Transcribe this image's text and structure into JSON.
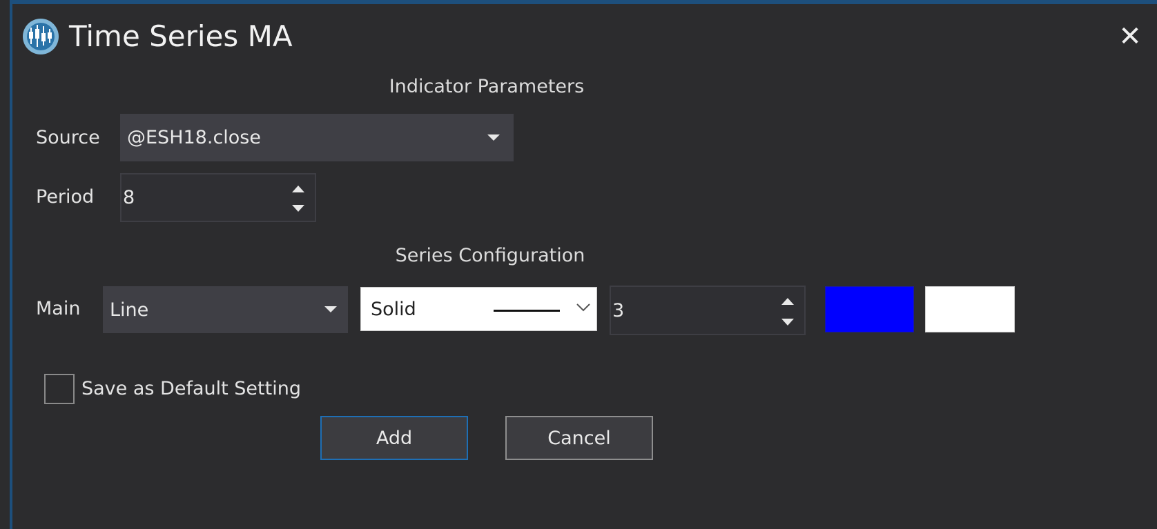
{
  "window": {
    "title": "Time Series MA",
    "close_symbol": "✕",
    "app_icon": "candlestick-chart-icon"
  },
  "indicator_parameters": {
    "heading": "Indicator Parameters",
    "source": {
      "label": "Source",
      "value": "@ESH18.close"
    },
    "period": {
      "label": "Period",
      "value": "8"
    }
  },
  "series_configuration": {
    "heading": "Series Configuration",
    "main": {
      "label": "Main",
      "plot_type": "Line",
      "line_style": "Solid",
      "width": "3",
      "color_1": "#0000ff",
      "color_2": "#ffffff"
    }
  },
  "save_default": {
    "label": "Save as Default Setting",
    "checked": false
  },
  "buttons": {
    "add": "Add",
    "cancel": "Cancel"
  },
  "colors": {
    "accent": "#1e6fb5",
    "background": "#2c2c2e",
    "field": "#3f3f45"
  }
}
